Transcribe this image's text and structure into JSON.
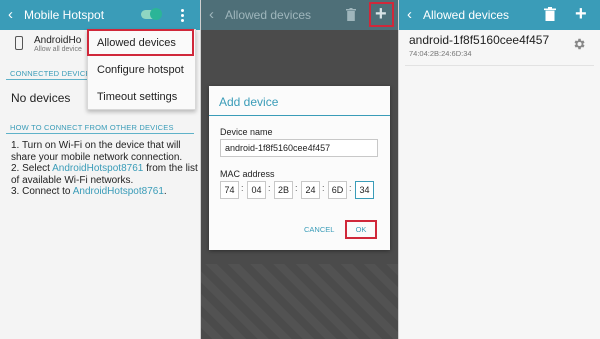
{
  "panel1": {
    "title": "Mobile Hotspot",
    "hotspot_name": "AndroidHo",
    "hotspot_sub": "Allow all device",
    "connected_header": "CONNECTED DEVICE",
    "no_devices": "No devices",
    "how_header": "HOW TO CONNECT FROM OTHER DEVICES",
    "steps": [
      [
        "1. Turn on Wi-Fi on the device that will share your mobile network connection."
      ],
      [
        "2. Select ",
        "AndroidHotspot8761",
        " from the list of available Wi-Fi networks."
      ],
      [
        "3. Connect to ",
        "AndroidHotspot8761",
        "."
      ]
    ],
    "menu": [
      "Allowed devices",
      "Configure hotspot",
      "Timeout settings"
    ]
  },
  "panel2": {
    "title": "Allowed devices",
    "dialog_title": "Add device",
    "device_name_label": "Device name",
    "device_name_value": "android-1f8f5160cee4f457",
    "mac_label": "MAC address",
    "mac_parts": [
      "74",
      "04",
      "2B",
      "24",
      "6D",
      "34"
    ],
    "cancel": "CANCEL",
    "ok": "OK"
  },
  "panel3": {
    "title": "Allowed devices",
    "device_name": "android-1f8f5160cee4f457",
    "device_mac": "74:04:2B:24:6D:34"
  },
  "icons": {
    "back": "chevron-left-icon",
    "more": "more-vert-icon",
    "add": "plus-icon",
    "delete": "trash-icon",
    "settings": "gear-icon",
    "phone": "phone-icon"
  },
  "colors": {
    "accent": "#3a9cb8",
    "highlight": "#d0283a",
    "toggle_on": "#2bb597"
  }
}
